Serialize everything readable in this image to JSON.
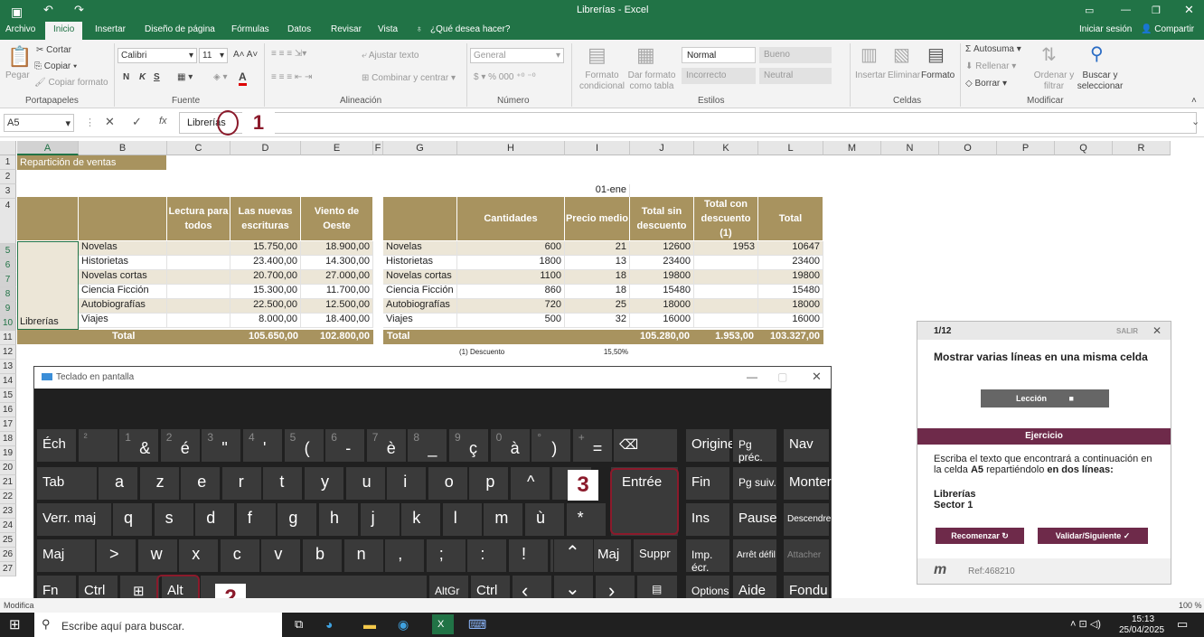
{
  "title": "Librerías - Excel",
  "account": "Iniciar sesión",
  "share": "Compartir",
  "tabs": [
    "Archivo",
    "Inicio",
    "Insertar",
    "Diseño de página",
    "Fórmulas",
    "Datos",
    "Revisar",
    "Vista"
  ],
  "tell_me": "¿Qué desea hacer?",
  "ribbon": {
    "paste": "Pegar",
    "cut": "Cortar",
    "copy": "Copiar",
    "format_painter": "Copiar formato",
    "clipboard": "Portapapeles",
    "font_name": "Calibri",
    "font_size": "11",
    "bold": "N",
    "italic": "K",
    "underline": "S",
    "font_group": "Fuente",
    "wrap": "Ajustar texto",
    "merge": "Combinar y centrar",
    "alignment": "Alineación",
    "number_format": "General",
    "number": "Número",
    "cond_format": "Formato condicional",
    "table_format": "Dar formato como tabla",
    "styles": {
      "normal": "Normal",
      "bueno": "Bueno",
      "incorrecto": "Incorrecto",
      "neutral": "Neutral"
    },
    "styles_group": "Estilos",
    "insert": "Insertar",
    "delete": "Eliminar",
    "format": "Formato",
    "cells": "Celdas",
    "autosum": "Autosuma",
    "fill": "Rellenar",
    "clear": "Borrar",
    "sort": "Ordenar y filtrar",
    "find": "Buscar y seleccionar",
    "modify": "Modificar"
  },
  "formula": {
    "name_box": "A5",
    "content": "Librerías"
  },
  "columns": [
    "A",
    "B",
    "C",
    "D",
    "E",
    "F",
    "G",
    "H",
    "I",
    "J",
    "K",
    "L",
    "M",
    "N",
    "O",
    "P",
    "Q",
    "R"
  ],
  "rows": [
    "1",
    "2",
    "3",
    "4",
    "5",
    "6",
    "7",
    "8",
    "9",
    "10",
    "11",
    "12",
    "13",
    "14",
    "15",
    "16",
    "17",
    "18",
    "19",
    "20",
    "21",
    "22",
    "23",
    "24",
    "25",
    "26",
    "27"
  ],
  "sheet": {
    "a1": "Repartición de ventas",
    "date": "01-ene",
    "left_headers": [
      "Lectura para todos",
      "Las nuevas escrituras",
      "Viento de Oeste"
    ],
    "right_headers": [
      "Cantidades",
      "Precio medio",
      "Total sin descuento",
      "Total con descuento (1)",
      "Total"
    ],
    "a10": "Librerías",
    "left_rows": [
      {
        "name": "Novelas",
        "d": "15.750,00",
        "e": "18.900,00"
      },
      {
        "name": "Historietas",
        "d": "23.400,00",
        "e": "14.300,00"
      },
      {
        "name": "Novelas cortas",
        "d": "20.700,00",
        "e": "27.000,00"
      },
      {
        "name": "Ciencia Ficción",
        "d": "15.300,00",
        "e": "11.700,00"
      },
      {
        "name": "Autobiografías",
        "d": "22.500,00",
        "e": "12.500,00"
      },
      {
        "name": "Viajes",
        "d": "8.000,00",
        "e": "18.400,00"
      }
    ],
    "right_rows": [
      {
        "name": "Novelas",
        "h": "600",
        "i": "21",
        "j": "12600",
        "k": "1953",
        "l": "10647"
      },
      {
        "name": "Historietas",
        "h": "1800",
        "i": "13",
        "j": "23400",
        "k": "",
        "l": "23400"
      },
      {
        "name": "Novelas cortas",
        "h": "1100",
        "i": "18",
        "j": "19800",
        "k": "",
        "l": "19800"
      },
      {
        "name": "Ciencia Ficción",
        "h": "860",
        "i": "18",
        "j": "15480",
        "k": "",
        "l": "15480"
      },
      {
        "name": "Autobiografías",
        "h": "720",
        "i": "25",
        "j": "18000",
        "k": "",
        "l": "18000"
      },
      {
        "name": "Viajes",
        "h": "500",
        "i": "32",
        "j": "16000",
        "k": "",
        "l": "16000"
      }
    ],
    "total_label": "Total",
    "left_total": {
      "d": "105.650,00",
      "e": "102.800,00"
    },
    "right_total": {
      "j": "105.280,00",
      "k": "1.953,00",
      "l": "103.327,00"
    },
    "note": "(1) Descuento",
    "note_value": "15,50%"
  },
  "keyboard": {
    "title": "Teclado en pantalla",
    "row1": [
      [
        "",
        "Éch"
      ],
      [
        "²",
        ""
      ],
      [
        "1",
        "&"
      ],
      [
        "2",
        "é"
      ],
      [
        "3",
        "\""
      ],
      [
        "4",
        "'"
      ],
      [
        "5",
        "("
      ],
      [
        "6",
        "-"
      ],
      [
        "7",
        "è"
      ],
      [
        "8",
        "_"
      ],
      [
        "9",
        "ç"
      ],
      [
        "0",
        "à"
      ],
      [
        "°",
        ")"
      ],
      [
        "+",
        "="
      ]
    ],
    "row2": [
      "Tab",
      "a",
      "z",
      "e",
      "r",
      "t",
      "y",
      "u",
      "i",
      "o",
      "p",
      "^",
      "£"
    ],
    "row3": [
      "Verr. maj",
      "q",
      "s",
      "d",
      "f",
      "g",
      "h",
      "j",
      "k",
      "l",
      "m",
      "ù",
      "*"
    ],
    "row4": [
      "Maj",
      ">",
      "w",
      "x",
      "c",
      "v",
      "b",
      "n",
      ",",
      ";",
      ":",
      "!",
      "^",
      "Maj",
      "Suppr"
    ],
    "row4_small": [
      "<",
      "",
      "",
      "",
      "",
      "",
      "",
      "?",
      ".",
      "/",
      "§"
    ],
    "row5": [
      "Fn",
      "Ctrl",
      "⊞",
      "Alt",
      "AltGr",
      "Ctrl",
      "<",
      ">"
    ],
    "enter": "Entrée",
    "right_keys": [
      "Origine",
      "Pg préc.",
      "Nav",
      "Fin",
      "Pg suiv.",
      "Monter",
      "Ins",
      "Pause",
      "Descendre",
      "Imp. écr.",
      "Arrêt défil",
      "Attacher",
      "Options",
      "Aide",
      "Fondu"
    ]
  },
  "panel": {
    "progress": "1/12",
    "exit": "SALIR",
    "heading": "Mostrar varias líneas en una misma celda",
    "lesson": "Lección",
    "exercise": "Ejercicio",
    "instructions_a": "Escriba el texto que encontrará a continuación en la celda ",
    "cell_ref": "A5",
    "instructions_b": " repartiéndolo ",
    "instructions_c": "en dos líneas:",
    "line1": "Librerías",
    "line2": "Sector 1",
    "restart": "Recomenzar",
    "validate": "Validar/Siguiente",
    "ref": "Ref:468210"
  },
  "annotations": [
    "1",
    "2",
    "3"
  ],
  "status": {
    "mode": "Modifica",
    "zoom": "100 %"
  },
  "taskbar": {
    "search": "Escribe aquí para buscar.",
    "time": "15:13",
    "date": "25/04/2025"
  },
  "colors": {
    "excel_green": "#217346",
    "header_gold": "#a8935f",
    "band": "#ece6d7",
    "accent": "#8b1a2b"
  }
}
